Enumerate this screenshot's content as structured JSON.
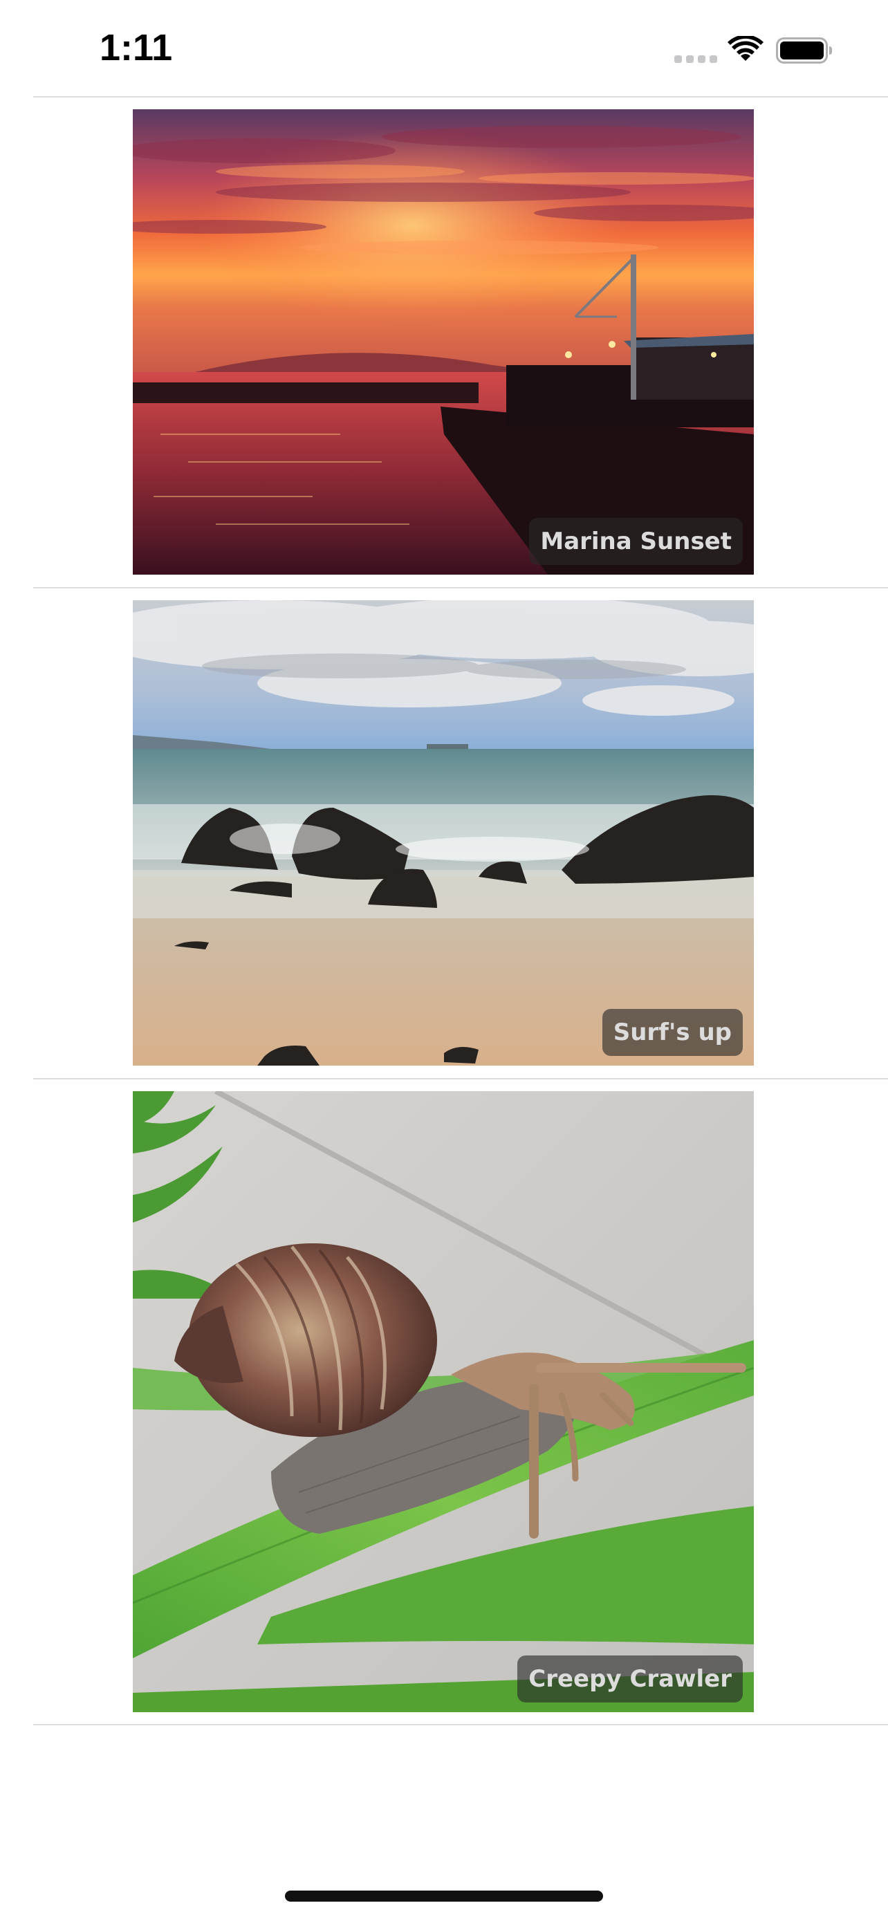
{
  "status_bar": {
    "time": "1:11",
    "signal_icon": "cellular-signal-icon",
    "wifi_icon": "wifi-icon",
    "battery_icon": "battery-icon"
  },
  "photos": [
    {
      "caption": "Marina Sunset",
      "image": "sunset-harbor-photo"
    },
    {
      "caption": "Surf's up",
      "image": "rocky-surf-photo"
    },
    {
      "caption": "Creepy Crawler",
      "image": "snail-on-leaf-photo"
    }
  ]
}
